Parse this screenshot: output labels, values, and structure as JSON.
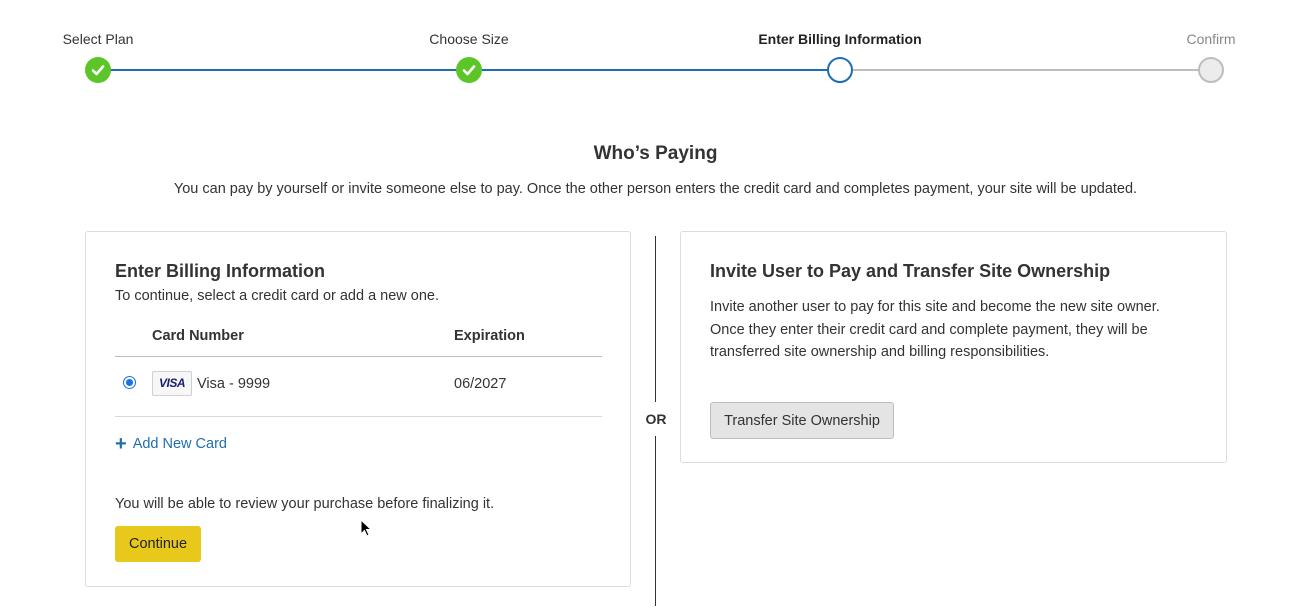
{
  "stepper": {
    "steps": [
      {
        "label": "Select Plan",
        "state": "complete"
      },
      {
        "label": "Choose Size",
        "state": "complete"
      },
      {
        "label": "Enter Billing Information",
        "state": "active"
      },
      {
        "label": "Confirm",
        "state": "upcoming"
      }
    ]
  },
  "header": {
    "title": "Who’s Paying",
    "subtitle": "You can pay by yourself or invite someone else to pay. Once the other person enters the credit card and completes payment, your site will be updated."
  },
  "billing": {
    "title": "Enter Billing Information",
    "instructions": "To continue, select a credit card or add a new one.",
    "columns": [
      "Card Number",
      "Expiration"
    ],
    "cards": [
      {
        "brand": "VISA",
        "label": "Visa - 9999",
        "expiration": "06/2027",
        "selected": true
      }
    ],
    "add_card_label": "Add New Card",
    "review_note": "You will be able to review your purchase before finalizing it.",
    "continue_label": "Continue"
  },
  "divider": {
    "label": "OR"
  },
  "invite": {
    "title": "Invite User to Pay and Transfer Site Ownership",
    "description": "Invite another user to pay for this site and become the new site owner. Once they enter their credit card and complete payment, they will be transferred site ownership and billing responsibilities.",
    "button_label": "Transfer Site Ownership"
  },
  "colors": {
    "complete": "#5cc628",
    "progress_line": "#1f6fb0",
    "primary_button": "#e8c81a",
    "link": "#1f6fb0"
  }
}
